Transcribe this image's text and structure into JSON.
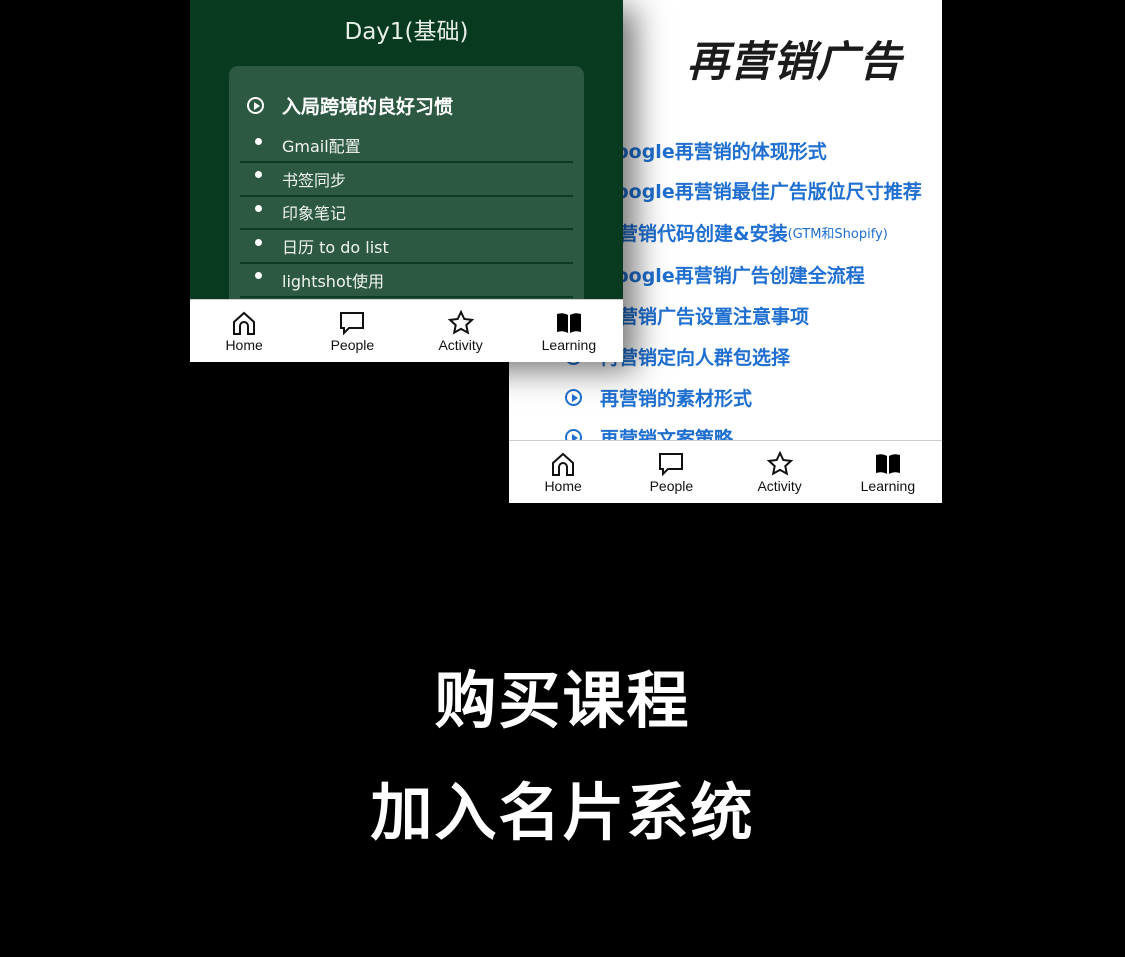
{
  "left_screen": {
    "title": "Day1(基础)",
    "section": {
      "heading": "入局跨境的良好习惯",
      "items": [
        "Gmail配置",
        "书签同步",
        "印象笔记",
        "日历 to do list",
        "lightshot使用"
      ]
    }
  },
  "right_screen": {
    "title": "再营销广告",
    "items": [
      {
        "text": "Google再营销的体现形式",
        "note": ""
      },
      {
        "text": "Google再营销最佳广告版位尺寸推荐",
        "note": ""
      },
      {
        "text": "再营销代码创建&安装",
        "note": "(GTM和Shopify)"
      },
      {
        "text": "Google再营销广告创建全流程",
        "note": ""
      },
      {
        "text": "再营销广告设置注意事项",
        "note": ""
      },
      {
        "text": "再营销定向人群包选择",
        "note": ""
      },
      {
        "text": "再营销的素材形式",
        "note": ""
      },
      {
        "text": "再营销文案策略",
        "note": ""
      }
    ]
  },
  "nav": {
    "home": "Home",
    "people": "People",
    "activity": "Activity",
    "learning": "Learning"
  },
  "promo": {
    "line1": "购买课程",
    "line2": "加入名片系统"
  },
  "colors": {
    "link": "#1f6fd0",
    "dark_green": "#073a1f",
    "card_green": "#2d5943"
  }
}
